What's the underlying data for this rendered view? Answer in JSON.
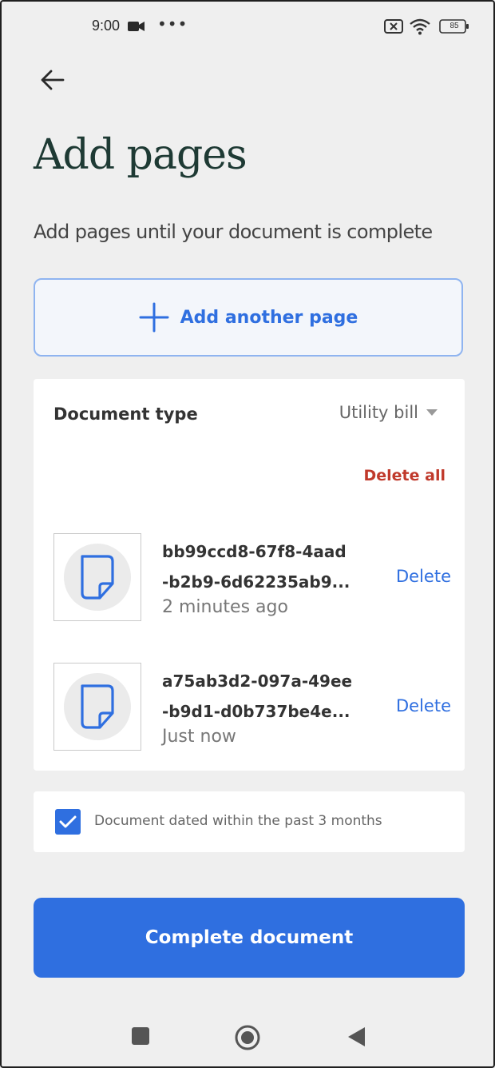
{
  "status_bar": {
    "time": "9:00",
    "dots": "•••",
    "battery": "85"
  },
  "header": {
    "back_icon": "arrow-left-icon",
    "title": "Add pages",
    "subtitle": "Add pages until your document is complete"
  },
  "add_page": {
    "icon": "plus-icon",
    "label": "Add another page"
  },
  "document": {
    "type_label": "Document type",
    "type_value": "Utility bill",
    "delete_all": "Delete all",
    "pages": [
      {
        "name_line1": "bb99ccd8-67f8-4aad",
        "name_line2": "-b2b9-6d62235ab9...",
        "time": "2 minutes ago",
        "delete_label": "Delete"
      },
      {
        "name_line1": "a75ab3d2-097a-49ee",
        "name_line2": "-b9d1-d0b737be4e...",
        "time": "Just now",
        "delete_label": "Delete"
      }
    ]
  },
  "date_check": {
    "checked": true,
    "label": "Document dated within the past 3 months"
  },
  "complete_button": {
    "label": "Complete document"
  },
  "colors": {
    "accent": "#2f6fe0",
    "danger": "#c0392b",
    "title": "#1e3a34",
    "background": "#efefef"
  }
}
